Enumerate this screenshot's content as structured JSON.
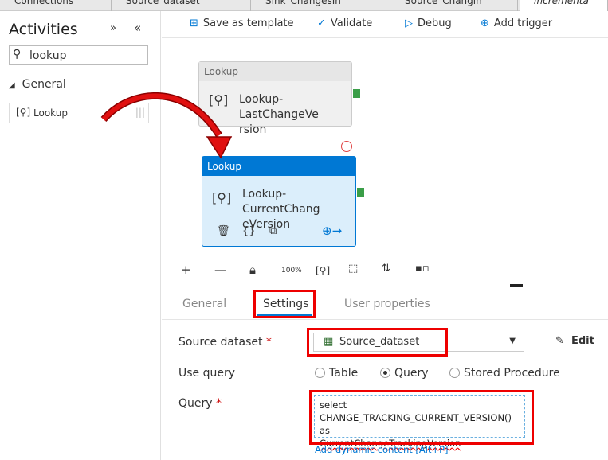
{
  "tabs": [
    {
      "label": "Connections"
    },
    {
      "label": "Source_dataset"
    },
    {
      "label": "Sink_ChangesIn"
    },
    {
      "label": "Source_Changin"
    },
    {
      "label": "Incrementa"
    }
  ],
  "toolbar": {
    "save_template": "Save as template",
    "validate": "Validate",
    "debug": "Debug",
    "add_trigger": "Add trigger"
  },
  "sidebar": {
    "title": "Activities",
    "search_value": "lookup",
    "group": "General",
    "item": "Lookup"
  },
  "canvas": {
    "nodes": [
      {
        "type": "Lookup",
        "name": "Lookup-LastChangeVe rsion",
        "line1": "Lookup-LastChangeVe",
        "line2": "rsion"
      },
      {
        "type": "Lookup",
        "name": "Lookup-CurrentChang eVersion",
        "line1": "Lookup-CurrentChang",
        "line2": "eVersion"
      }
    ]
  },
  "zoom_toolbar": {
    "fit_label": "100%"
  },
  "panel": {
    "tabs": [
      "General",
      "Settings",
      "User properties"
    ],
    "active_tab": "Settings",
    "source_dataset_label": "Source dataset",
    "source_dataset_value": "Source_dataset",
    "edit_label": "Edit",
    "use_query_label": "Use query",
    "options": [
      "Table",
      "Query",
      "Stored Procedure"
    ],
    "selected_option": "Query",
    "query_label": "Query",
    "query_lines": [
      "select",
      "CHANGE_TRACKING_CURRENT_VERSION() as",
      "CurrentChangeTrackingVersion"
    ],
    "dynamic_link": "Add dynamic content [Alt+P]",
    "required_mark": "*"
  },
  "colors": {
    "accent": "#0078d4",
    "highlight": "#e00000",
    "success": "#3a9e48"
  }
}
